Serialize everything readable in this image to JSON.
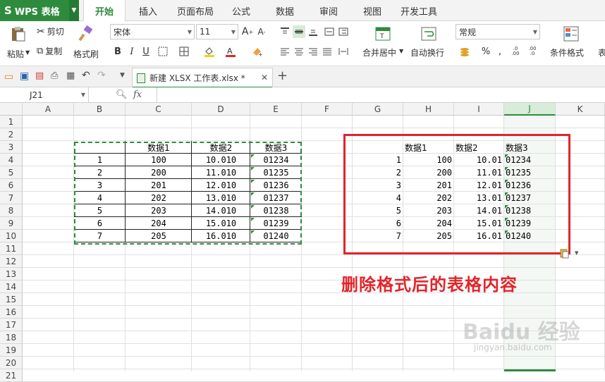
{
  "app": {
    "logo_text": "WPS 表格"
  },
  "tabs": [
    "开始",
    "插入",
    "页面布局",
    "公式",
    "数据",
    "审阅",
    "视图",
    "开发工具"
  ],
  "ribbon": {
    "paste": "粘贴",
    "cut": "剪切",
    "copy": "复制",
    "format_painter": "格式刷",
    "font_name": "宋体",
    "font_size": "11",
    "merge_center": "合并居中",
    "wrap_text": "自动换行",
    "number_format": "常规",
    "conditional_format": "条件格式",
    "table_style_partial": "表"
  },
  "document": {
    "tab_title": "新建 XLSX 工作表.xlsx *"
  },
  "formula_bar": {
    "name_box": "J21",
    "fx": "fx",
    "formula": ""
  },
  "sheet": {
    "columns": [
      "A",
      "B",
      "C",
      "D",
      "E",
      "F",
      "G",
      "H",
      "I",
      "J",
      "K"
    ],
    "selected_column": "J",
    "rows": [
      "1",
      "2",
      "3",
      "4",
      "5",
      "6",
      "7",
      "8",
      "9",
      "10",
      "11",
      "12",
      "13",
      "14",
      "15",
      "16",
      "17",
      "18",
      "19",
      "20",
      "21"
    ],
    "left_table": {
      "headers": [
        "",
        "数据1",
        "数据2",
        "数据3"
      ],
      "rows": [
        [
          "1",
          "100",
          "10.010",
          "01234"
        ],
        [
          "2",
          "200",
          "11.010",
          "01235"
        ],
        [
          "3",
          "201",
          "12.010",
          "01236"
        ],
        [
          "4",
          "202",
          "13.010",
          "01237"
        ],
        [
          "5",
          "203",
          "14.010",
          "01238"
        ],
        [
          "6",
          "204",
          "15.010",
          "01239"
        ],
        [
          "7",
          "205",
          "16.010",
          "01240"
        ]
      ]
    },
    "right_table": {
      "headers": [
        "",
        "数据1",
        "数据2",
        "数据3"
      ],
      "rows": [
        [
          "1",
          "100",
          "10.01",
          "01234"
        ],
        [
          "2",
          "200",
          "11.01",
          "01235"
        ],
        [
          "3",
          "201",
          "12.01",
          "01236"
        ],
        [
          "4",
          "202",
          "13.01",
          "01237"
        ],
        [
          "5",
          "203",
          "14.01",
          "01238"
        ],
        [
          "6",
          "204",
          "15.01",
          "01239"
        ],
        [
          "7",
          "205",
          "16.01",
          "01240"
        ]
      ]
    },
    "annotation": "删除格式后的表格内容"
  },
  "watermark": {
    "text": "Baidu 经验",
    "sub": "jingyan.baidu.com"
  },
  "colors": {
    "wps_green": "#2e8b3d",
    "annotation_red": "#e1252b"
  }
}
